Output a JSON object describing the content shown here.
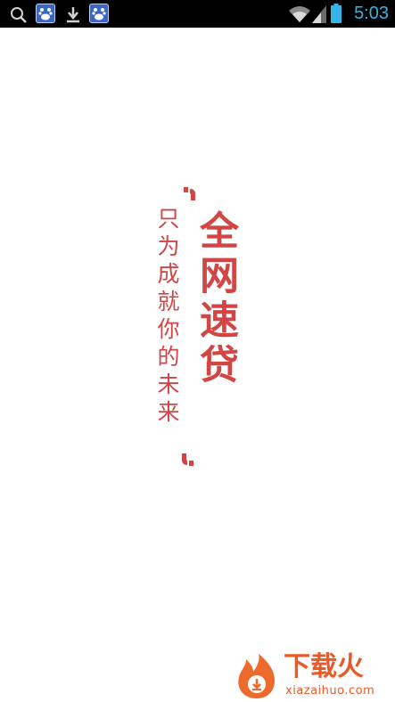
{
  "status_bar": {
    "time": "5:03",
    "icons": [
      "search-icon",
      "baidu-app-icon",
      "download-icon",
      "baidu-app-icon",
      "wifi-icon",
      "signal-icon",
      "battery-icon"
    ],
    "time_color": "#33b5e5"
  },
  "splash": {
    "title": "全网速贷",
    "tagline": "只为成就你的未来",
    "accent_color": "#d24545"
  },
  "watermark": {
    "title": "下载火",
    "domain": "xiazaihuo.com",
    "color": "#e85a2a"
  }
}
